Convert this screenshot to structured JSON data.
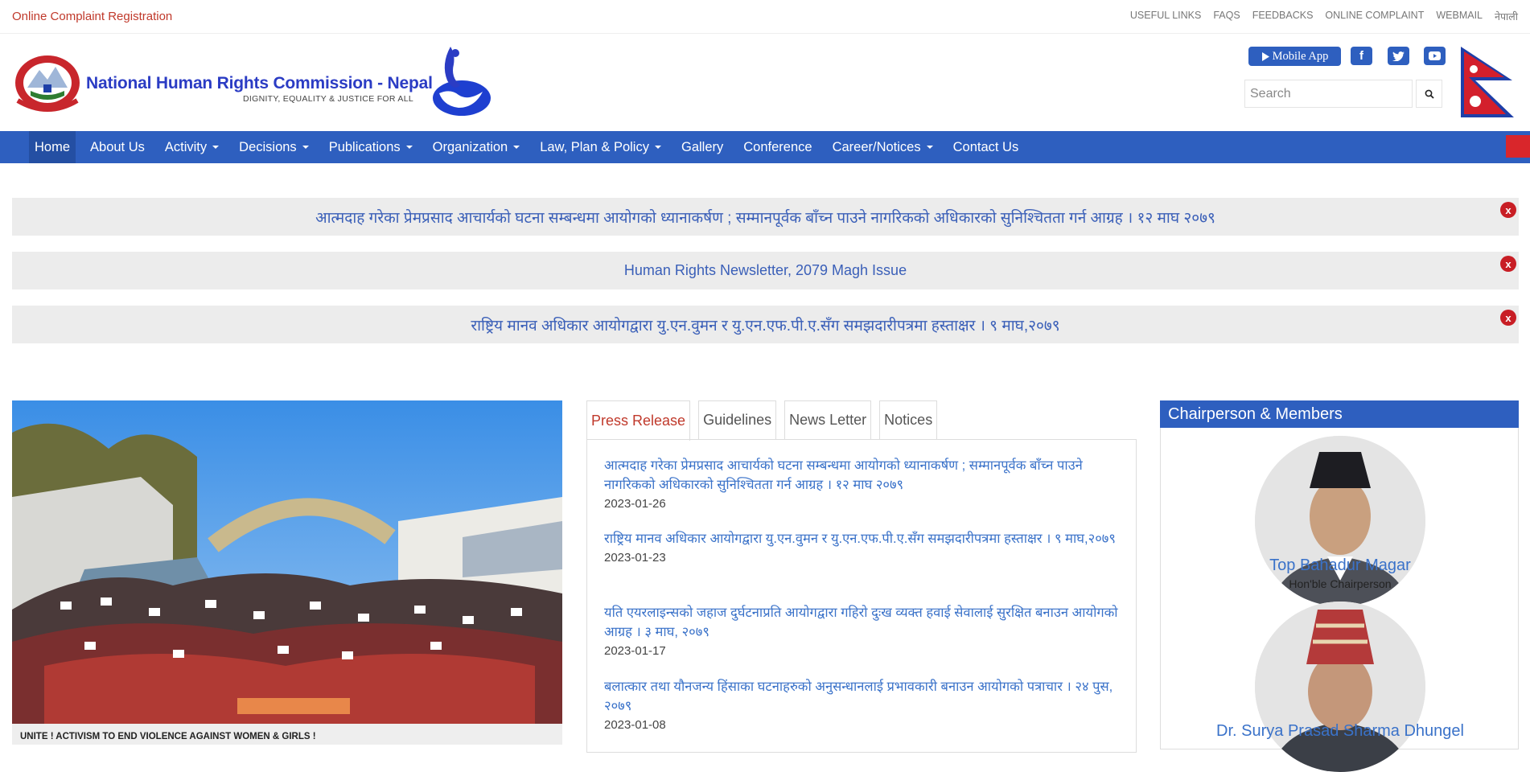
{
  "topbar": {
    "complaint_link": "Online Complaint Registration",
    "links": [
      "USEFUL LINKS",
      "FAQS",
      "FEEDBACKS",
      "ONLINE COMPLAINT",
      "WEBMAIL",
      "नेपाली"
    ]
  },
  "header": {
    "title": "National Human Rights Commission - Nepal",
    "tagline": "DIGNITY, EQUALITY & JUSTICE FOR ALL",
    "mobile_app": "Mobile App",
    "social_icons": [
      "facebook-icon",
      "twitter-icon",
      "youtube-icon"
    ],
    "search_placeholder": "Search"
  },
  "nav": {
    "items": [
      {
        "label": "Home",
        "dropdown": false
      },
      {
        "label": "About Us",
        "dropdown": false
      },
      {
        "label": "Activity",
        "dropdown": true
      },
      {
        "label": "Decisions",
        "dropdown": true
      },
      {
        "label": "Publications",
        "dropdown": true
      },
      {
        "label": "Organization",
        "dropdown": true
      },
      {
        "label": "Law, Plan & Policy",
        "dropdown": true
      },
      {
        "label": "Gallery",
        "dropdown": false
      },
      {
        "label": "Conference",
        "dropdown": false
      },
      {
        "label": "Career/Notices",
        "dropdown": true
      },
      {
        "label": "Contact Us",
        "dropdown": false
      }
    ]
  },
  "notices": [
    "आत्मदाह गरेका प्रेमप्रसाद आचार्यको घटना सम्बन्धमा आयोगको ध्यानाकर्षण ; सम्मानपूर्वक बाँच्न पाउने नागरिकको अधिकारको सुनिश्चितता गर्न आग्रह । १२ माघ २०७९",
    "Human Rights Newsletter, 2079 Magh Issue",
    "राष्ट्रिय मानव अधिकार आयोगद्वारा यु.एन.वुमन र यु.एन.एफ.पी.ए.सँग समझदारीपत्रमा हस्ताक्षर । ९ माघ,२०७९"
  ],
  "photo": {
    "caption": "UNITE ! ACTIVISM TO END VIOLENCE AGAINST WOMEN & GIRLS !"
  },
  "tabs": {
    "labels": [
      "Press Release",
      "Guidelines",
      "News Letter",
      "Notices"
    ],
    "press_releases": [
      {
        "title": "आत्मदाह गरेका प्रेमप्रसाद आचार्यको घटना सम्बन्धमा आयोगको ध्यानाकर्षण ; सम्मानपूर्वक बाँच्न पाउने नागरिकको अधिकारको सुनिश्चितता गर्न आग्रह । १२ माघ २०७९",
        "date": "2023-01-26"
      },
      {
        "title": "राष्ट्रिय मानव अधिकार आयोगद्वारा यु.एन.वुमन र यु.एन.एफ.पी.ए.सँग समझदारीपत्रमा हस्ताक्षर । ९ माघ,२०७९",
        "date": "2023-01-23"
      },
      {
        "title": "यति एयरलाइन्सको जहाज दुर्घटनाप्रति आयोगद्वारा गहिरो दुःख व्यक्त हवाई सेवालाई सुरक्षित बनाउन आयोगको आग्रह । ३ माघ, २०७९",
        "date": "2023-01-17"
      },
      {
        "title": "बलात्कार तथा यौनजन्य हिंसाका घटनाहरुको अनुसन्धानलाई प्रभावकारी बनाउन आयोगको पत्राचार । २४ पुस, २०७९",
        "date": "2023-01-08"
      }
    ]
  },
  "members": {
    "heading": "Chairperson & Members",
    "list": [
      {
        "name": "Top Bahadur Magar",
        "role": "Hon'ble Chairperson"
      },
      {
        "name": "Dr. Surya Prasad Sharma Dhungel",
        "role": ""
      }
    ]
  },
  "colors": {
    "brand_blue": "#2e5fbf",
    "link_blue": "#3a72c9",
    "accent_red": "#c81e25"
  }
}
